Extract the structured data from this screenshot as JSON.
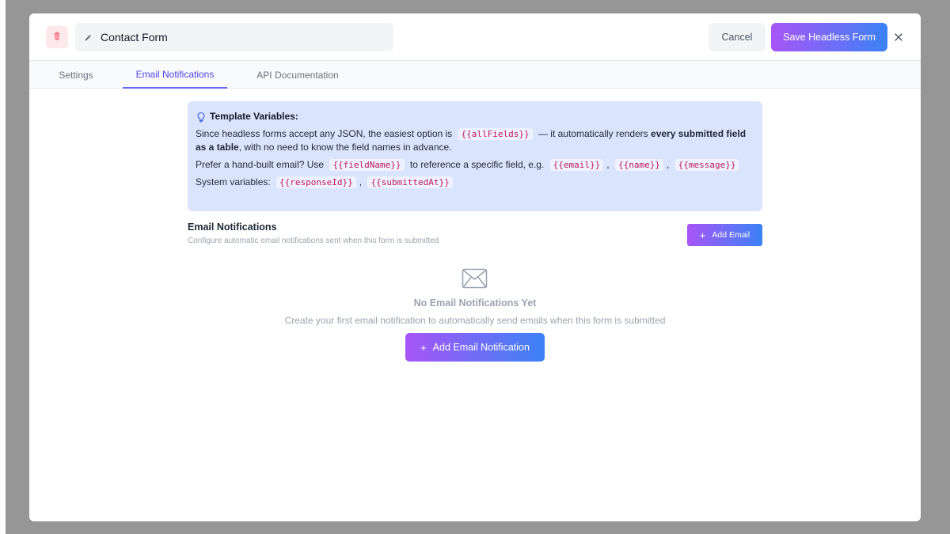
{
  "colors": {
    "backdrop": "#969696",
    "accent_gradient_start": "#a855f7",
    "accent_gradient_end": "#3b82f6",
    "active_tab": "#4f46e5",
    "info_box_bg": "#dbe4fd",
    "code_text": "#be185d",
    "danger_bg": "#fde8ec"
  },
  "header": {
    "form_title": "Contact Form",
    "cancel_label": "Cancel",
    "save_label": "Save Headless Form",
    "icons": [
      "trash-icon",
      "pencil-icon",
      "close-icon"
    ]
  },
  "tabs": [
    {
      "label": "Settings",
      "active": false
    },
    {
      "label": "Email Notifications",
      "active": true
    },
    {
      "label": "API Documentation",
      "active": false
    }
  ],
  "info": {
    "title": "Template Variables:",
    "line1_a": "Since headless forms accept any JSON, the easiest option is",
    "line1_code": "{{allFields}}",
    "line1_b": "— it automatically renders",
    "line1_bold": "every submitted field as a table",
    "line1_c": ", with no need to know the field names in advance.",
    "line2_a": "Prefer a hand-built email? Use",
    "line2_code1": "{{fieldName}}",
    "line2_b": "to reference a specific field, e.g.",
    "line2_code2": "{{email}}",
    "line2_sep1": ",",
    "line2_code3": "{{name}}",
    "line2_sep2": ",",
    "line2_code4": "{{message}}",
    "line3_a": "System variables:",
    "line3_code1": "{{responseId}}",
    "line3_sep": ",",
    "line3_code2": "{{submittedAt}}"
  },
  "section": {
    "title": "Email Notifications",
    "subtitle": "Configure automatic email notifications sent when this form is submitted",
    "add_email_label": "Add Email"
  },
  "empty_state": {
    "icon": "envelope-icon",
    "title": "No Email Notifications Yet",
    "subtitle": "Create your first email notification to automatically send emails when this form is submitted",
    "button_label": "Add Email Notification"
  }
}
